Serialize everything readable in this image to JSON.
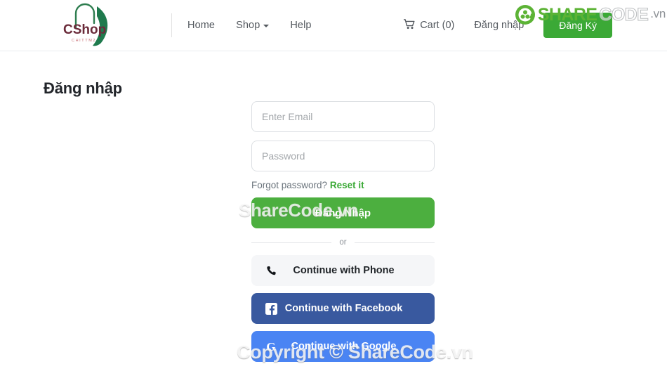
{
  "header": {
    "logo": {
      "name": "CShop",
      "tagline": "CHITTM2",
      "text_color": "#6b2b3a",
      "bag_color": "#1f7a4d",
      "tagline_color": "#c76b72"
    },
    "nav": [
      {
        "label": "Home",
        "icon": null
      },
      {
        "label": "Shop",
        "icon": "chevron-down-icon"
      },
      {
        "label": "Help",
        "icon": null
      }
    ],
    "cart": {
      "label": "Cart (0)",
      "icon": "shopping-cart-icon",
      "count": 0
    },
    "login_link": "Đăng nhập",
    "register_button": "Đăng Ký",
    "register_color": "#3ba936"
  },
  "page": {
    "title": "Đăng nhập"
  },
  "form": {
    "email": {
      "placeholder": "Enter Email",
      "value": ""
    },
    "password": {
      "placeholder": "Password",
      "value": ""
    },
    "forgot_text": "Forgot password?",
    "reset_link": "Reset it",
    "reset_color": "#3ba936",
    "submit_label": "Đăng Nhập",
    "submit_color": "#4caf3f",
    "divider_text": "or",
    "social": [
      {
        "label": "Continue with Phone",
        "icon": "phone-icon",
        "color": "#f5f6f8"
      },
      {
        "label": "Continue with Facebook",
        "icon": "facebook-icon",
        "color": "#39599f"
      },
      {
        "label": "Continue with Google",
        "icon": "google-icon",
        "color": "#4a84f3"
      }
    ]
  },
  "watermarks": {
    "center": "ShareCode.vn",
    "bottom": "Copyright © ShareCode.vn",
    "logo_share": "SHARE",
    "logo_code": "CODE",
    "logo_tld": ".vn"
  }
}
